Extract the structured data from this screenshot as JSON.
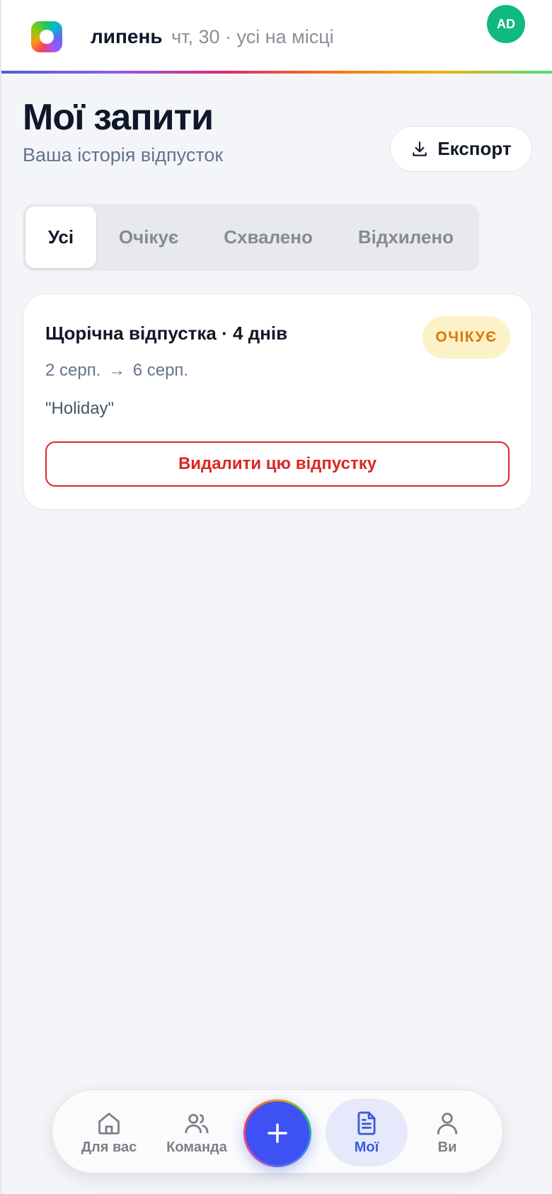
{
  "header": {
    "month": "липень",
    "meta": "чт, 30 · усі на місці",
    "avatar_initials": "AD"
  },
  "page": {
    "title": "Мої запити",
    "subtitle": "Ваша історія відпусток",
    "export_label": "Експорт"
  },
  "tabs": [
    {
      "label": "Усі",
      "active": true
    },
    {
      "label": "Очікує",
      "active": false
    },
    {
      "label": "Схвалено",
      "active": false
    },
    {
      "label": "Відхилено",
      "active": false
    }
  ],
  "requests": [
    {
      "title": "Щорічна відпустка · 4 днів",
      "status": "ОЧІКУЄ",
      "date_start": "2 серп.",
      "date_arrow": "→",
      "date_end": "6 серп.",
      "note": "\"Holiday\"",
      "delete_label": "Видалити цю відпустку"
    }
  ],
  "nav": {
    "items": [
      {
        "label": "Для вас",
        "icon": "home-icon"
      },
      {
        "label": "Команда",
        "icon": "users-icon"
      },
      {
        "label": "Мої",
        "icon": "document-icon",
        "active": true
      },
      {
        "label": "Ви",
        "icon": "user-icon"
      }
    ],
    "fab_icon": "plus-icon"
  },
  "colors": {
    "accent": "#3d51f5",
    "avatar": "#10b981",
    "pending_bg": "#fdf1c7",
    "pending_text": "#d97706",
    "danger": "#dc2626"
  }
}
